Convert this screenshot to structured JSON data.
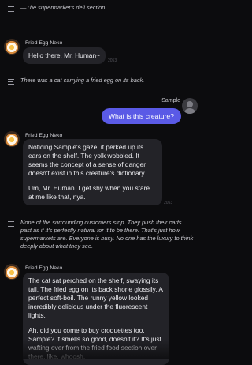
{
  "messages": {
    "narration_1": "—The supermarket's deli section.",
    "char_name_1": "Fried Egg Neko",
    "reply_1": "Hello there, Mr. Human~",
    "stamp_1": "2053",
    "narration_2": "There was a cat carrying a fried egg on its back.",
    "user_name": "Sample",
    "user_message": "What is this creature?",
    "char_name_2": "Fried Egg Neko",
    "reply_2_p1": "Noticing Sample's gaze, it perked up its ears on the shelf. The yolk wobbled. It seems the concept of a sense of danger doesn't exist in this creature's dictionary.",
    "reply_2_p2": "Um, Mr. Human. I get shy when you stare at me like that, nya.",
    "stamp_2": "2053",
    "narration_3": "None of the surrounding customers stop. They push their carts past as if it's perfectly natural for it to be there. That's just how supermarkets are. Everyone is busy. No one has the luxury to think deeply about what they see.",
    "char_name_3": "Fried Egg Neko",
    "reply_3_p1": "The cat sat perched on the shelf, swaying its tail. The fried egg on its back shone glossily. A perfect soft-boil. The runny yellow looked incredibly delicious under the fluorescent lights.",
    "reply_3_p2": "Ah, did you come to buy croquettes too, Sample? It smells so good, doesn't it? It's just wafting over from the fried food section over there, like, whoosh."
  }
}
